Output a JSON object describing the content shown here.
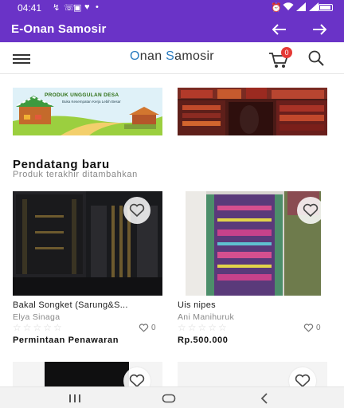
{
  "status_bar": {
    "time": "04:41"
  },
  "app_bar": {
    "title": "E-Onan Samosir"
  },
  "header": {
    "brand_o": "O",
    "brand_rest1": "nan ",
    "brand_s": "S",
    "brand_rest2": "amosir",
    "cart_count": "0"
  },
  "banners": {
    "banner1_title": "PRODUK UNGGULAN DESA",
    "banner1_subtitle": "Buka Kesempatan Kerja Lebih Besar"
  },
  "section": {
    "title": "Pendatang baru",
    "subtitle": "Produk terakhir ditambahkan"
  },
  "products": [
    {
      "name": "Bakal Songket (Sarung&S...",
      "seller": "Elya Sinaga",
      "stars": "☆☆☆☆☆",
      "likes": "0",
      "price": "Permintaan Penawaran"
    },
    {
      "name": "Uis nipes",
      "seller": "Ani Manihuruk",
      "stars": "☆☆☆☆☆",
      "likes": "0",
      "price": "Rp.500.000"
    }
  ],
  "colors": {
    "primary": "#6a33c7",
    "brand_accent": "#2a7bbf",
    "badge": "#e53935"
  },
  "icons": [
    "back-arrow-icon",
    "forward-arrow-icon",
    "menu-icon",
    "cart-icon",
    "search-icon",
    "heart-icon"
  ]
}
